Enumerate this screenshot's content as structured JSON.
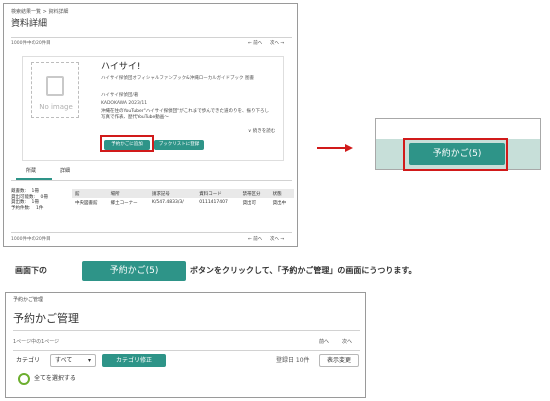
{
  "top_screen": {
    "breadcrumb": "検索結果一覧 > 資料詳細",
    "page_title": "資料詳細",
    "record_position": "1000件中の20件目",
    "prev_label": "← 前へ",
    "next_label": "次へ →",
    "cover_placeholder": "No image",
    "book": {
      "title": "ハイサイ!",
      "subtitle": "ハイサイ探偵団オフィシャルファンブック&沖縄ローカルガイドブック 图書",
      "author": "ハイサイ探偵団/著",
      "publisher": "KADOKAWA 2023/11",
      "description": "沖縄在住のYouTuber\"ハイサイ探偵団\"がこれまで歩んできた道のりを、振り下ろし写真で作表、歴代YouTube動画～",
      "read_more": "∨ 続きを読む"
    },
    "reserve_cart_button": "予約かごに追加",
    "booklist_button": "ブックリストに登録",
    "tabs": [
      "所蔵",
      "詳細"
    ],
    "holdings_summary": [
      {
        "label": "蔵書数:",
        "value": "1冊"
      },
      {
        "label": "貸出可能数:",
        "value": "0冊"
      },
      {
        "label": "貸出数:",
        "value": "1冊"
      },
      {
        "label": "予約件数:",
        "value": "1件"
      }
    ],
    "holdings_table": {
      "headers": [
        "館",
        "場所",
        "請求記号",
        "資料コード",
        "禁帯区分",
        "状態"
      ],
      "rows": [
        [
          "中央図書館",
          "郷土コーナー",
          "K/547.4833/3/",
          "0111417407",
          "貸出可",
          "貸出中"
        ]
      ]
    },
    "footer_position": "1000件中の20件目",
    "footer_prev": "← 前へ",
    "footer_next": "次へ →"
  },
  "zoom_callout": {
    "button_label": "予約かご(5)"
  },
  "instruction": {
    "prefix": "画面下の",
    "button_label": "予約かご(5)",
    "suffix": "ボタンをクリックして、「予約かご管理」の画面にうつります。"
  },
  "bottom_screen": {
    "breadcrumb": "予約かご管理",
    "page_title": "予約かご管理",
    "page_info": "1ページ中の1ページ",
    "prev_label": "前へ",
    "next_label": "次へ",
    "category_label": "カテゴリ",
    "category_value": "すべて",
    "category_fix_button": "カテゴリ修正",
    "sort_label": "登録日 10件",
    "display_change_button": "表示変更",
    "select_all_label": "全てを選択する"
  },
  "colors": {
    "accent_teal": "#2e9488",
    "callout_red": "#d11a1a"
  }
}
